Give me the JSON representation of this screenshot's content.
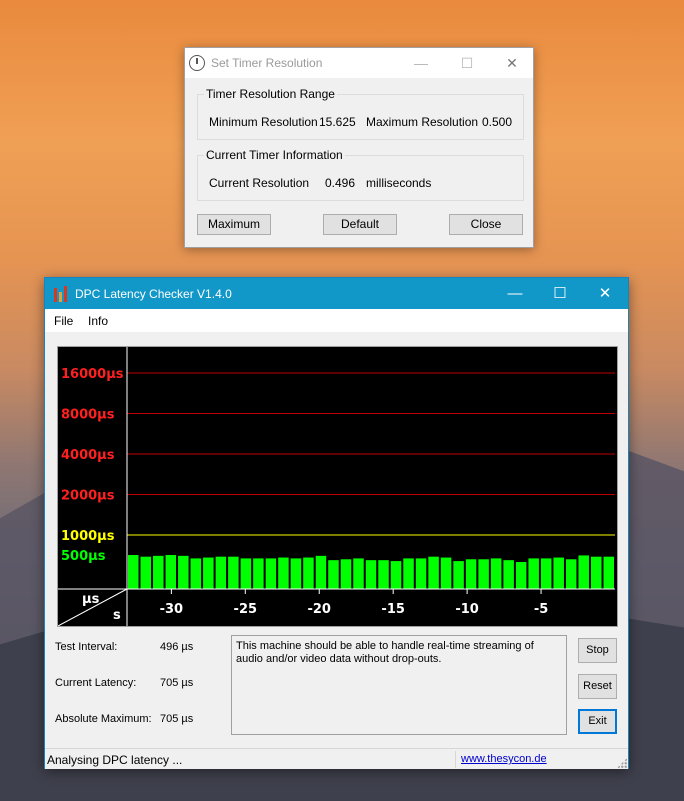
{
  "timer_window": {
    "title": "Set Timer Resolution",
    "buttons": {
      "minimize": "—",
      "maximize": "☐",
      "close": "✕"
    },
    "range_group": {
      "label": "Timer Resolution Range",
      "min_label": "Minimum Resolution",
      "min_value": "15.625",
      "max_label": "Maximum Resolution",
      "max_value": "0.500"
    },
    "current_group": {
      "label": "Current Timer Information",
      "current_label": "Current Resolution",
      "current_value": "0.496",
      "unit": "milliseconds"
    },
    "actions": {
      "maximum": "Maximum",
      "default": "Default",
      "close": "Close"
    }
  },
  "dpc_window": {
    "title": "DPC Latency Checker V1.4.0",
    "buttons": {
      "minimize": "—",
      "maximize": "☐",
      "close": "✕"
    },
    "menu": {
      "file": "File",
      "info": "Info"
    },
    "stats": {
      "test_interval_label": "Test Interval:",
      "test_interval_value": "496 µs",
      "current_latency_label": "Current Latency:",
      "current_latency_value": "705 µs",
      "absolute_max_label": "Absolute Maximum:",
      "absolute_max_value": "705 µs"
    },
    "message": "This machine should be able to handle real-time streaming of audio and/or video data without drop-outs.",
    "side_buttons": {
      "stop": "Stop",
      "reset": "Reset",
      "exit": "Exit"
    },
    "status": {
      "text": "Analysing DPC latency ...",
      "link": "www.thesycon.de"
    }
  },
  "colors": {
    "red_line": "#c00000",
    "red_label": "#ff2020",
    "yellow": "#ffff00",
    "bar_green": "#00ff00",
    "label_green": "#00ff00"
  },
  "chart_data": {
    "type": "bar",
    "y_unit_label": "µs",
    "x_unit_label": "s",
    "y_thresholds": [
      {
        "label": "16000µs",
        "value": 16000,
        "color": "#ff2020",
        "line": "#c00000"
      },
      {
        "label": "8000µs",
        "value": 8000,
        "color": "#ff2020",
        "line": "#c00000"
      },
      {
        "label": "4000µs",
        "value": 4000,
        "color": "#ff2020",
        "line": "#c00000"
      },
      {
        "label": "2000µs",
        "value": 2000,
        "color": "#ff2020",
        "line": "#c00000"
      },
      {
        "label": "1000µs",
        "value": 1000,
        "color": "#ffff00",
        "line": "#ffff00"
      },
      {
        "label": "500µs",
        "value": 500,
        "color": "#00ff00",
        "line": null
      }
    ],
    "x_ticks": [
      "-30",
      "-25",
      "-20",
      "-15",
      "-10",
      "-5"
    ],
    "x_tick_values": [
      -30,
      -25,
      -20,
      -15,
      -10,
      -5
    ],
    "x_range": [
      -33,
      0
    ],
    "y_scale": "log2",
    "values": [
      710,
      690,
      700,
      710,
      700,
      670,
      680,
      690,
      690,
      670,
      670,
      670,
      680,
      670,
      680,
      700,
      650,
      660,
      670,
      650,
      650,
      640,
      670,
      670,
      690,
      680,
      640,
      660,
      660,
      670,
      650,
      630,
      670,
      670,
      680,
      660,
      705,
      690,
      690
    ]
  }
}
